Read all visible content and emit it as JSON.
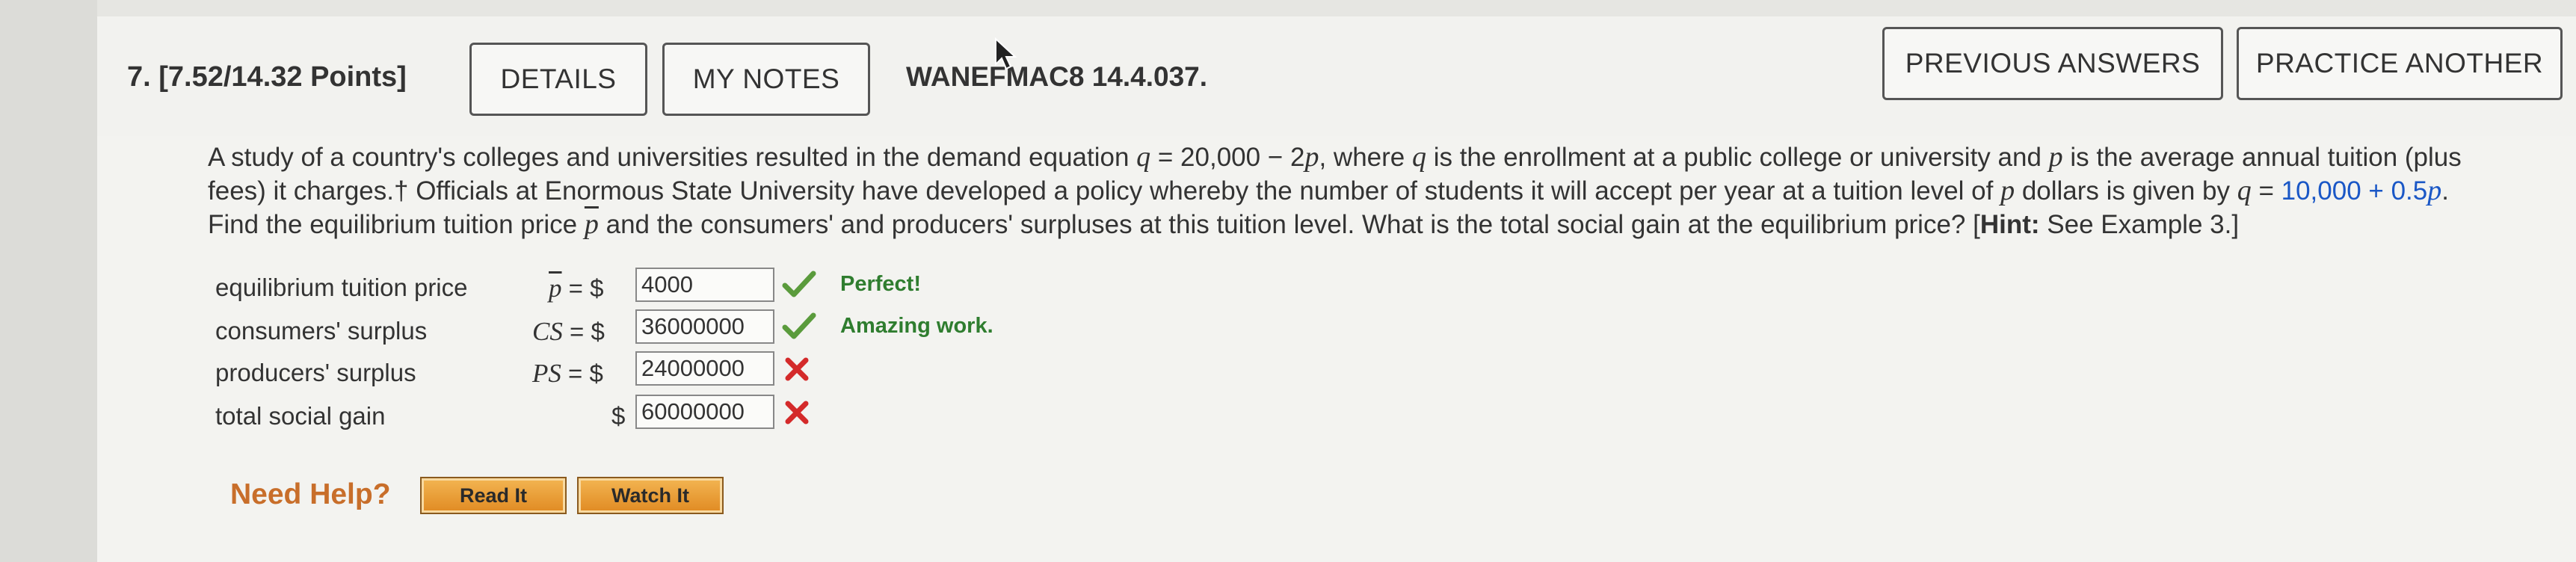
{
  "header": {
    "question_label": "7.  [7.52/14.32 Points]",
    "details_label": "DETAILS",
    "my_notes_label": "MY NOTES",
    "reference": "WANEFMAC8 14.4.037.",
    "previous_answers_label": "PREVIOUS ANSWERS",
    "practice_another_label": "PRACTICE ANOTHER"
  },
  "problem": {
    "part1": "A study of a country's colleges and universities resulted in the demand equation ",
    "eq1_var": "q",
    "eq1_rest": " = 20,000 − 2",
    "eq1_p": "p",
    "part2": ", where ",
    "q2": "q",
    "part3": " is the enrollment at a public college or university and ",
    "p2": "p",
    "part4": " is the average annual tuition (plus",
    "line2a": "fees) it charges.† Officials at Enormous State University have developed a policy whereby the number of students it will accept per year at a tuition level of ",
    "p3": "p",
    "line2b": " dollars is given by ",
    "q3": "q",
    "line2c": " = ",
    "supply_eq": "10,000 + 0.5",
    "supply_p": "p",
    "line2d": ".",
    "line3a": "Find the equilibrium tuition price ",
    "pbar": "p",
    "line3b": " and the consumers' and producers' surpluses at this tuition level. What is the total social gain at the equilibrium price? [",
    "hint_bold": "Hint:",
    "line3c": " See Example 3.]"
  },
  "answers": [
    {
      "label": "equilibrium tuition price",
      "symbol": "p",
      "eq": " = $",
      "value": "4000",
      "status": "correct",
      "feedback": "Perfect!"
    },
    {
      "label": "consumers' surplus",
      "symbol": "CS",
      "eq": " = $",
      "value": "36000000",
      "status": "correct",
      "feedback": "Amazing work."
    },
    {
      "label": "producers' surplus",
      "symbol": "PS",
      "eq": " = $",
      "value": "24000000",
      "status": "incorrect",
      "feedback": ""
    },
    {
      "label": "total social gain",
      "symbol": "",
      "eq": "$",
      "value": "60000000",
      "status": "incorrect",
      "feedback": ""
    }
  ],
  "help": {
    "label": "Need Help?",
    "read_it": "Read It",
    "watch_it": "Watch It"
  },
  "colors": {
    "accent_blue": "#1a57c6",
    "correct_green": "#5a9b3c",
    "incorrect_red": "#d42a2a",
    "help_orange": "#c86e2a"
  },
  "icons": {
    "check": "check-icon",
    "cross": "cross-icon",
    "cursor": "mouse-cursor-icon"
  }
}
